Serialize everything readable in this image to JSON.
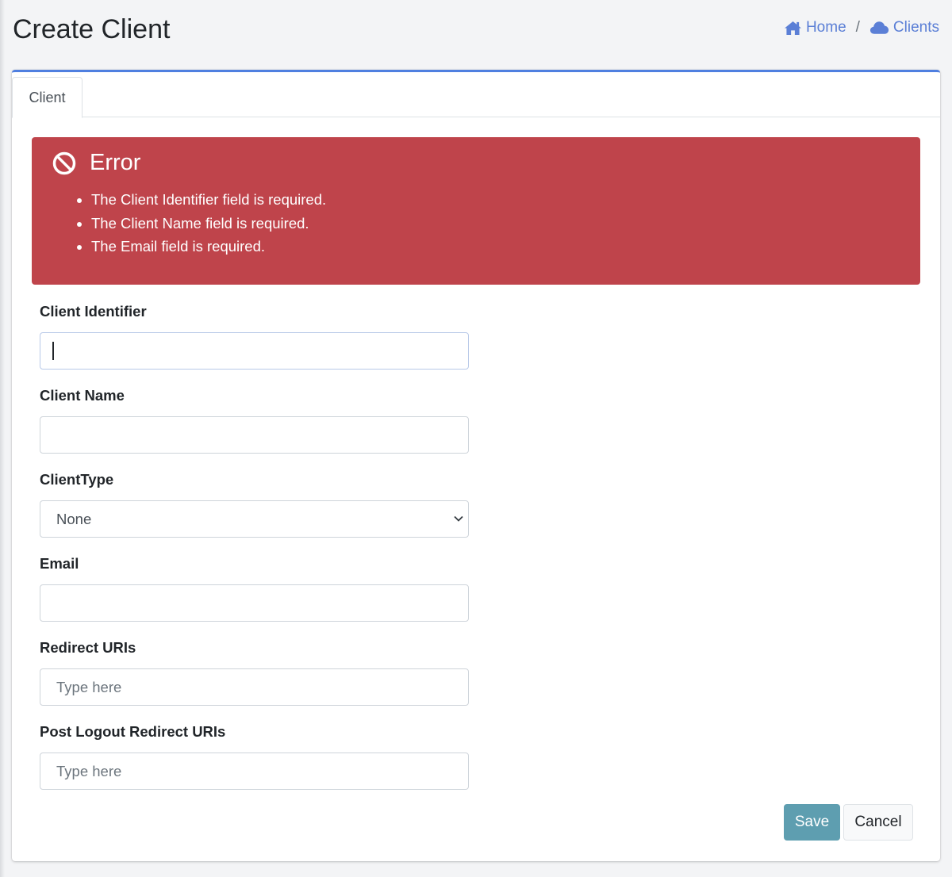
{
  "page": {
    "title": "Create Client"
  },
  "breadcrumb": [
    {
      "label": "Home",
      "icon": "home-icon"
    },
    {
      "label": "Clients",
      "icon": "cloud-icon"
    }
  ],
  "breadcrumb_separator": "/",
  "tabs": [
    {
      "label": "Client",
      "active": true
    }
  ],
  "alert": {
    "title": "Error",
    "icon": "ban-icon",
    "color": "#bf444b",
    "messages": [
      "The Client Identifier field is required.",
      "The Client Name field is required.",
      "The Email field is required."
    ]
  },
  "form": {
    "client_identifier": {
      "label": "Client Identifier",
      "value": "",
      "placeholder": ""
    },
    "client_name": {
      "label": "Client Name",
      "value": "",
      "placeholder": ""
    },
    "client_type": {
      "label": "ClientType",
      "selected": "None"
    },
    "email": {
      "label": "Email",
      "value": "",
      "placeholder": ""
    },
    "redirect_uris": {
      "label": "Redirect URIs",
      "value": "",
      "placeholder": "Type here"
    },
    "post_logout_redirect_uris": {
      "label": "Post Logout Redirect URIs",
      "value": "",
      "placeholder": "Type here"
    }
  },
  "actions": {
    "save_label": "Save",
    "cancel_label": "Cancel"
  },
  "colors": {
    "accent": "#4f7fe0",
    "link": "#5b7fd6",
    "save_button": "#5e9eb0"
  }
}
